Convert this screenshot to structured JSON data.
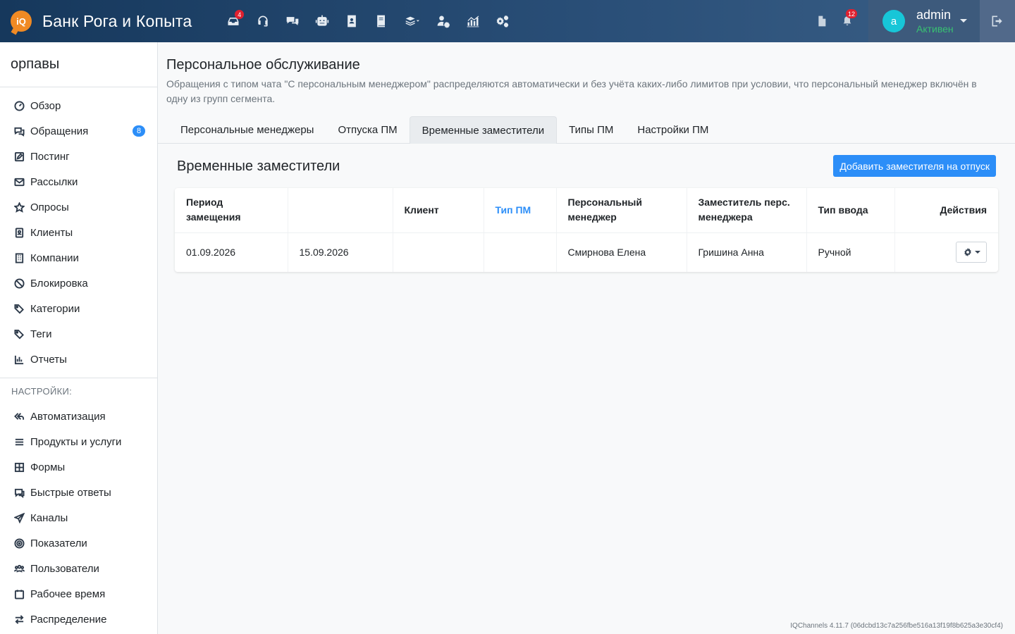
{
  "header": {
    "logo_text": "iQ",
    "brand": "Банк Рога и Копыта",
    "icons": [
      {
        "name": "inbox-icon",
        "badge": "4"
      },
      {
        "name": "headset-icon",
        "badge": ""
      },
      {
        "name": "chat-icon",
        "badge": ""
      },
      {
        "name": "robot-icon",
        "badge": ""
      },
      {
        "name": "contacts-icon",
        "badge": ""
      },
      {
        "name": "book-icon",
        "badge": ""
      },
      {
        "name": "layers-icon",
        "badge": ""
      },
      {
        "name": "user-settings-icon",
        "badge": ""
      },
      {
        "name": "analytics-icon",
        "badge": ""
      },
      {
        "name": "cogs-icon",
        "badge": ""
      }
    ],
    "notifications_count": "12",
    "user": {
      "avatar_letter": "a",
      "name": "admin",
      "status": "Активен"
    }
  },
  "sidebar": {
    "org_name": "орпавы",
    "items": [
      {
        "label": "Обзор",
        "icon": "dashboard-icon"
      },
      {
        "label": "Обращения",
        "icon": "chats-icon",
        "badge": "8"
      },
      {
        "label": "Постинг",
        "icon": "edit-icon"
      },
      {
        "label": "Рассылки",
        "icon": "mail-icon"
      },
      {
        "label": "Опросы",
        "icon": "star-icon"
      },
      {
        "label": "Клиенты",
        "icon": "contact-book-icon"
      },
      {
        "label": "Компании",
        "icon": "building-icon"
      },
      {
        "label": "Блокировка",
        "icon": "ban-icon"
      },
      {
        "label": "Категории",
        "icon": "tags-icon"
      },
      {
        "label": "Теги",
        "icon": "tag-icon"
      },
      {
        "label": "Отчеты",
        "icon": "bar-chart-icon"
      }
    ],
    "settings_heading": "НАСТРОЙКИ:",
    "settings_items": [
      {
        "label": "Автоматизация",
        "icon": "automation-icon"
      },
      {
        "label": "Продукты и услуги",
        "icon": "list-icon"
      },
      {
        "label": "Формы",
        "icon": "grid-icon"
      },
      {
        "label": "Быстрые ответы",
        "icon": "quick-reply-icon"
      },
      {
        "label": "Каналы",
        "icon": "send-icon"
      },
      {
        "label": "Показатели",
        "icon": "target-icon"
      },
      {
        "label": "Пользователи",
        "icon": "users-icon"
      },
      {
        "label": "Рабочее время",
        "icon": "calendar-icon"
      },
      {
        "label": "Распределение",
        "icon": "exchange-icon"
      }
    ]
  },
  "page": {
    "title": "Персональное обслуживание",
    "description": "Обращения с типом чата \"С персональным менеджером\" распределяются автоматически и без учёта каких-либо лимитов при условии, что персональный менеджер включён в одну из групп сегмента.",
    "tabs": [
      {
        "label": "Персональные менеджеры",
        "active": false
      },
      {
        "label": "Отпуска ПМ",
        "active": false
      },
      {
        "label": "Временные заместители",
        "active": true
      },
      {
        "label": "Типы ПМ",
        "active": false
      },
      {
        "label": "Настройки ПМ",
        "active": false
      }
    ],
    "section_title": "Временные заместители",
    "add_button": "Добавить заместителя на отпуск",
    "table": {
      "headers": [
        "Период замещения",
        "",
        "Клиент",
        "Тип ПМ",
        "Персональный менеджер",
        "Заместитель перс. менеджера",
        "Тип ввода",
        "Действия"
      ],
      "rows": [
        [
          "01.09.2026",
          "15.09.2026",
          "",
          "",
          "Смирнова Елена",
          "Гришина Анна",
          "Ручной"
        ]
      ]
    },
    "version": "IQChannels 4.11.7 (06dcbd13c7a256fbe516a13f19f8b625a3e30cf4)"
  }
}
